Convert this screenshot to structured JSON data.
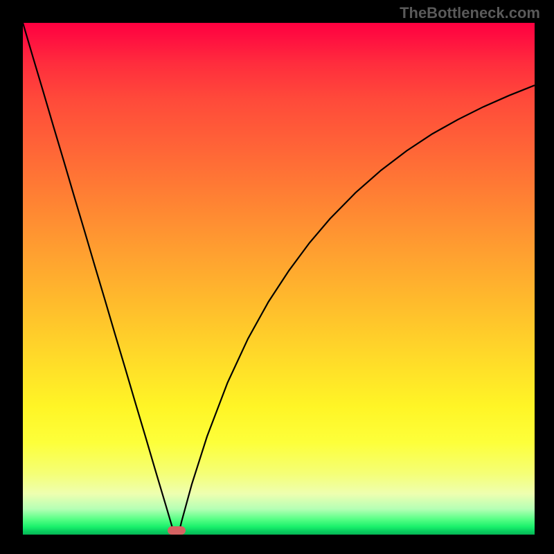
{
  "watermark": "TheBottleneck.com",
  "chart_data": {
    "type": "line",
    "title": "",
    "xlabel": "",
    "ylabel": "",
    "xlim": [
      0,
      1
    ],
    "ylim": [
      0,
      1
    ],
    "x": [
      0.0,
      0.02,
      0.04,
      0.06,
      0.08,
      0.1,
      0.12,
      0.14,
      0.16,
      0.18,
      0.2,
      0.22,
      0.24,
      0.26,
      0.28,
      0.29,
      0.295,
      0.3,
      0.305,
      0.31,
      0.33,
      0.36,
      0.4,
      0.44,
      0.48,
      0.52,
      0.56,
      0.6,
      0.65,
      0.7,
      0.75,
      0.8,
      0.85,
      0.9,
      0.95,
      1.0
    ],
    "values": [
      1.0,
      0.932,
      0.865,
      0.797,
      0.73,
      0.662,
      0.595,
      0.527,
      0.46,
      0.392,
      0.325,
      0.257,
      0.19,
      0.122,
      0.055,
      0.021,
      0.004,
      0.0,
      0.004,
      0.025,
      0.098,
      0.192,
      0.297,
      0.383,
      0.455,
      0.516,
      0.57,
      0.617,
      0.668,
      0.712,
      0.75,
      0.783,
      0.811,
      0.836,
      0.858,
      0.878
    ],
    "marker_x": 0.3
  }
}
